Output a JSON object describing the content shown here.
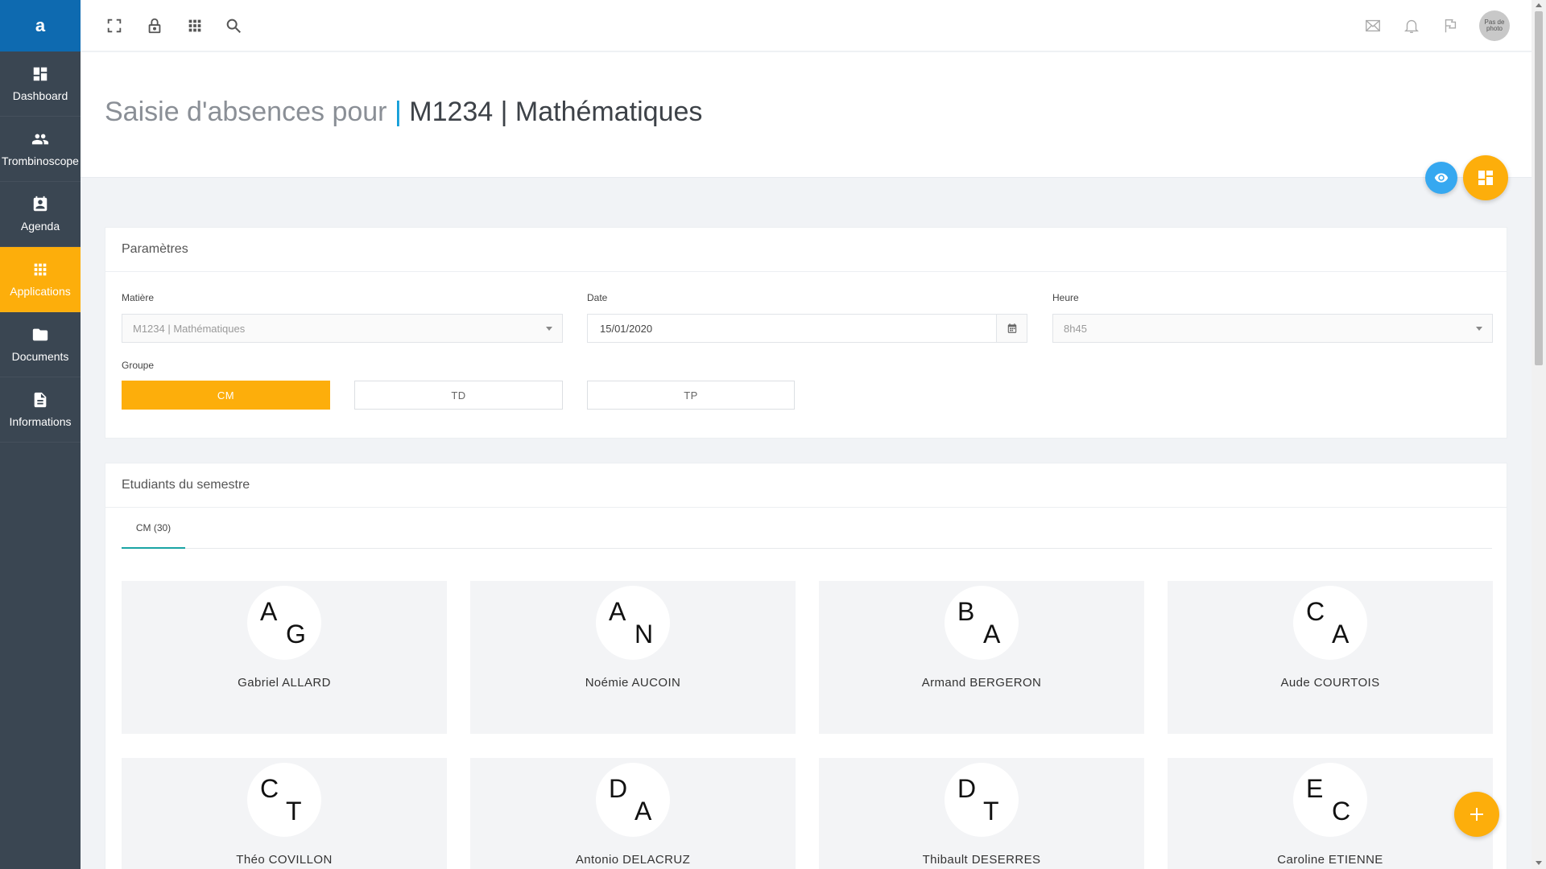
{
  "brand": {
    "logo": "a"
  },
  "sidebar": {
    "items": [
      {
        "label": "Dashboard",
        "icon": "dashboard-icon",
        "active": false
      },
      {
        "label": "Trombinoscope",
        "icon": "people-icon",
        "active": false
      },
      {
        "label": "Agenda",
        "icon": "contact-book-icon",
        "active": false
      },
      {
        "label": "Applications",
        "icon": "apps-grid-icon",
        "active": true
      },
      {
        "label": "Documents",
        "icon": "folder-icon",
        "active": false
      },
      {
        "label": "Informations",
        "icon": "file-icon",
        "active": false
      }
    ]
  },
  "topbar": {
    "left_icons": [
      "fullscreen-icon",
      "lock-icon",
      "apps-grid-icon",
      "search-icon"
    ],
    "right_icons": [
      "mail-icon",
      "bell-icon",
      "flag-icon"
    ],
    "avatar_text": "Pas de photo"
  },
  "header": {
    "title_prefix": "Saisie d'absences pour",
    "title_sep": "|",
    "title_main": "M1234 | Mathématiques"
  },
  "params": {
    "title": "Paramètres",
    "matiere": {
      "label": "Matière",
      "value": "M1234 | Mathématiques"
    },
    "date": {
      "label": "Date",
      "value": "15/01/2020"
    },
    "heure": {
      "label": "Heure",
      "value": "8h45"
    },
    "groupe": {
      "label": "Groupe",
      "options": [
        "CM",
        "TD",
        "TP"
      ],
      "selected": "CM"
    }
  },
  "students": {
    "title": "Etudiants du semestre",
    "tab_label": "CM (30)",
    "list": [
      {
        "first": "A",
        "second": "G",
        "name": "Gabriel ALLARD"
      },
      {
        "first": "A",
        "second": "N",
        "name": "Noémie AUCOIN"
      },
      {
        "first": "B",
        "second": "A",
        "name": "Armand BERGERON"
      },
      {
        "first": "C",
        "second": "A",
        "name": "Aude COURTOIS"
      },
      {
        "first": "C",
        "second": "T",
        "name": "Théo COVILLON"
      },
      {
        "first": "D",
        "second": "A",
        "name": "Antonio DELACRUZ"
      },
      {
        "first": "D",
        "second": "T",
        "name": "Thibault DESERRES"
      },
      {
        "first": "E",
        "second": "C",
        "name": "Caroline ETIENNE"
      }
    ]
  },
  "colors": {
    "accent": "#fdae0b",
    "sidebar": "#3a4652",
    "brand": "#0e6ab0",
    "eye_button": "#36a8f0"
  }
}
